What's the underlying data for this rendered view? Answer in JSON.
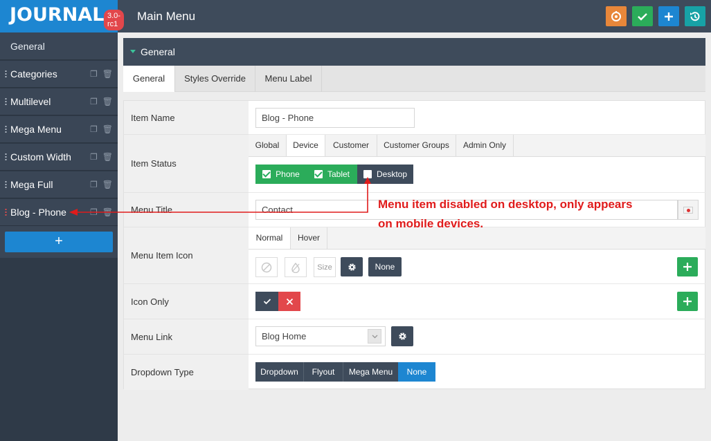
{
  "header": {
    "logo": "JOURNAL",
    "version": "3.0-rc1",
    "title": "Main Menu",
    "buttons": [
      {
        "name": "reset-icon",
        "color": "#e8873a"
      },
      {
        "name": "check-icon",
        "color": "#2bac5a"
      },
      {
        "name": "plus-icon",
        "color": "#1d86d1"
      },
      {
        "name": "history-icon",
        "color": "#17a2a6"
      }
    ]
  },
  "sidebar": {
    "general": "General",
    "items": [
      {
        "label": "Categories"
      },
      {
        "label": "Multilevel"
      },
      {
        "label": "Mega Menu"
      },
      {
        "label": "Custom Width"
      },
      {
        "label": "Mega Full"
      },
      {
        "label": "Blog - Phone"
      }
    ],
    "add_label": "+"
  },
  "panel": {
    "title": "General",
    "tabs": [
      "General",
      "Styles Override",
      "Menu Label"
    ],
    "active_tab": "General"
  },
  "form": {
    "item_name": {
      "label": "Item Name",
      "value": "Blog - Phone"
    },
    "item_status": {
      "label": "Item Status",
      "tabs": [
        "Global",
        "Device",
        "Customer",
        "Customer Groups",
        "Admin Only"
      ],
      "active_tab": "Device",
      "devices": [
        {
          "label": "Phone",
          "checked": true
        },
        {
          "label": "Tablet",
          "checked": true
        },
        {
          "label": "Desktop",
          "checked": false
        }
      ]
    },
    "menu_title": {
      "label": "Menu Title",
      "value": "Contact"
    },
    "menu_item_icon": {
      "label": "Menu Item Icon",
      "tabs": [
        "Normal",
        "Hover"
      ],
      "active_tab": "Normal",
      "size_placeholder": "Size",
      "none_label": "None"
    },
    "icon_only": {
      "label": "Icon Only"
    },
    "menu_link": {
      "label": "Menu Link",
      "value": "Blog Home"
    },
    "dropdown_type": {
      "label": "Dropdown Type",
      "options": [
        "Dropdown",
        "Flyout",
        "Mega Menu",
        "None"
      ],
      "selected": "None"
    }
  },
  "annotation": {
    "line1": "Menu item disabled on desktop, only appears",
    "line2": "on mobile devices.",
    "color": "#e01b1b"
  }
}
